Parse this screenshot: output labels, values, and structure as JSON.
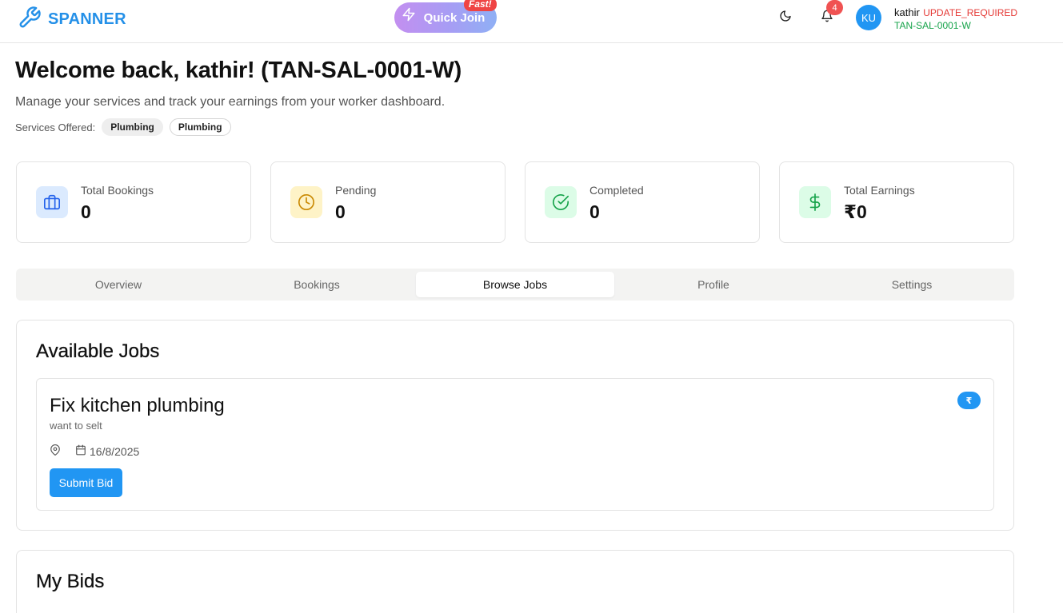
{
  "header": {
    "brand_name": "SPANNER",
    "quick_join_label": "Quick Join",
    "fast_badge": "Fast!",
    "notification_count": "4",
    "avatar_initials": "KU",
    "user_name": "kathir",
    "user_status": "UPDATE_REQUIRED",
    "user_id": "TAN-SAL-0001-W"
  },
  "welcome": {
    "title": "Welcome back, kathir! (TAN-SAL-0001-W)",
    "subtitle": "Manage your services and track your earnings from your worker dashboard.",
    "services_label": "Services Offered:",
    "services": [
      "Plumbing",
      "Plumbing"
    ]
  },
  "stats": [
    {
      "label": "Total Bookings",
      "value": "0",
      "icon": "briefcase-icon",
      "icon_bg": "#dbeafe",
      "icon_color": "#2563eb"
    },
    {
      "label": "Pending",
      "value": "0",
      "icon": "clock-icon",
      "icon_bg": "#fef3c7",
      "icon_color": "#ca8a04"
    },
    {
      "label": "Completed",
      "value": "0",
      "icon": "check-circle-icon",
      "icon_bg": "#dcfce7",
      "icon_color": "#16a34a"
    },
    {
      "label": "Total Earnings",
      "value": "₹0",
      "icon": "dollar-icon",
      "icon_bg": "#dcfce7",
      "icon_color": "#16a34a"
    }
  ],
  "tabs": [
    {
      "label": "Overview",
      "active": false
    },
    {
      "label": "Bookings",
      "active": false
    },
    {
      "label": "Browse Jobs",
      "active": true
    },
    {
      "label": "Profile",
      "active": false
    },
    {
      "label": "Settings",
      "active": false
    }
  ],
  "available_jobs": {
    "title": "Available Jobs",
    "jobs": [
      {
        "title": "Fix kitchen plumbing",
        "description": "want to selt",
        "location": "",
        "date": "16/8/2025",
        "price_badge": "₹",
        "submit_label": "Submit Bid"
      }
    ]
  },
  "my_bids": {
    "title": "My Bids"
  },
  "colors": {
    "brand": "#2490e8",
    "primary_button": "#2196f3",
    "status_error": "#e53935",
    "status_success": "#16a34a",
    "notification": "#f05252"
  }
}
